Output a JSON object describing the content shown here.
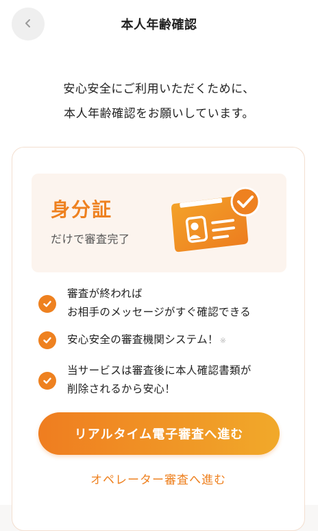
{
  "header": {
    "title": "本人年齢確認",
    "back_icon": "chevron-left-icon"
  },
  "intro": {
    "line1": "安心安全にご利用いただくために、",
    "line2": "本人年齢確認をお願いしています。"
  },
  "promo": {
    "title": "身分証",
    "subtitle": "だけで審査完了",
    "illustration_icon": "id-card-check-icon"
  },
  "checklist": [
    {
      "lines": [
        "審査が終われば",
        "お相手のメッセージがすぐ確認できる"
      ]
    },
    {
      "lines": [
        "安心安全の審査機関システム！"
      ],
      "note": "※"
    },
    {
      "lines": [
        "当サービスは審査後に本人確認書類が",
        "削除されるから安心！"
      ]
    }
  ],
  "actions": {
    "primary_label": "リアルタイム電子審査へ進む",
    "secondary_label": "オペレーター審査へ進む"
  },
  "colors": {
    "accent": "#ee8120",
    "accent_gradient_end": "#f1a92a",
    "promo_bg": "#fcf4ee"
  }
}
